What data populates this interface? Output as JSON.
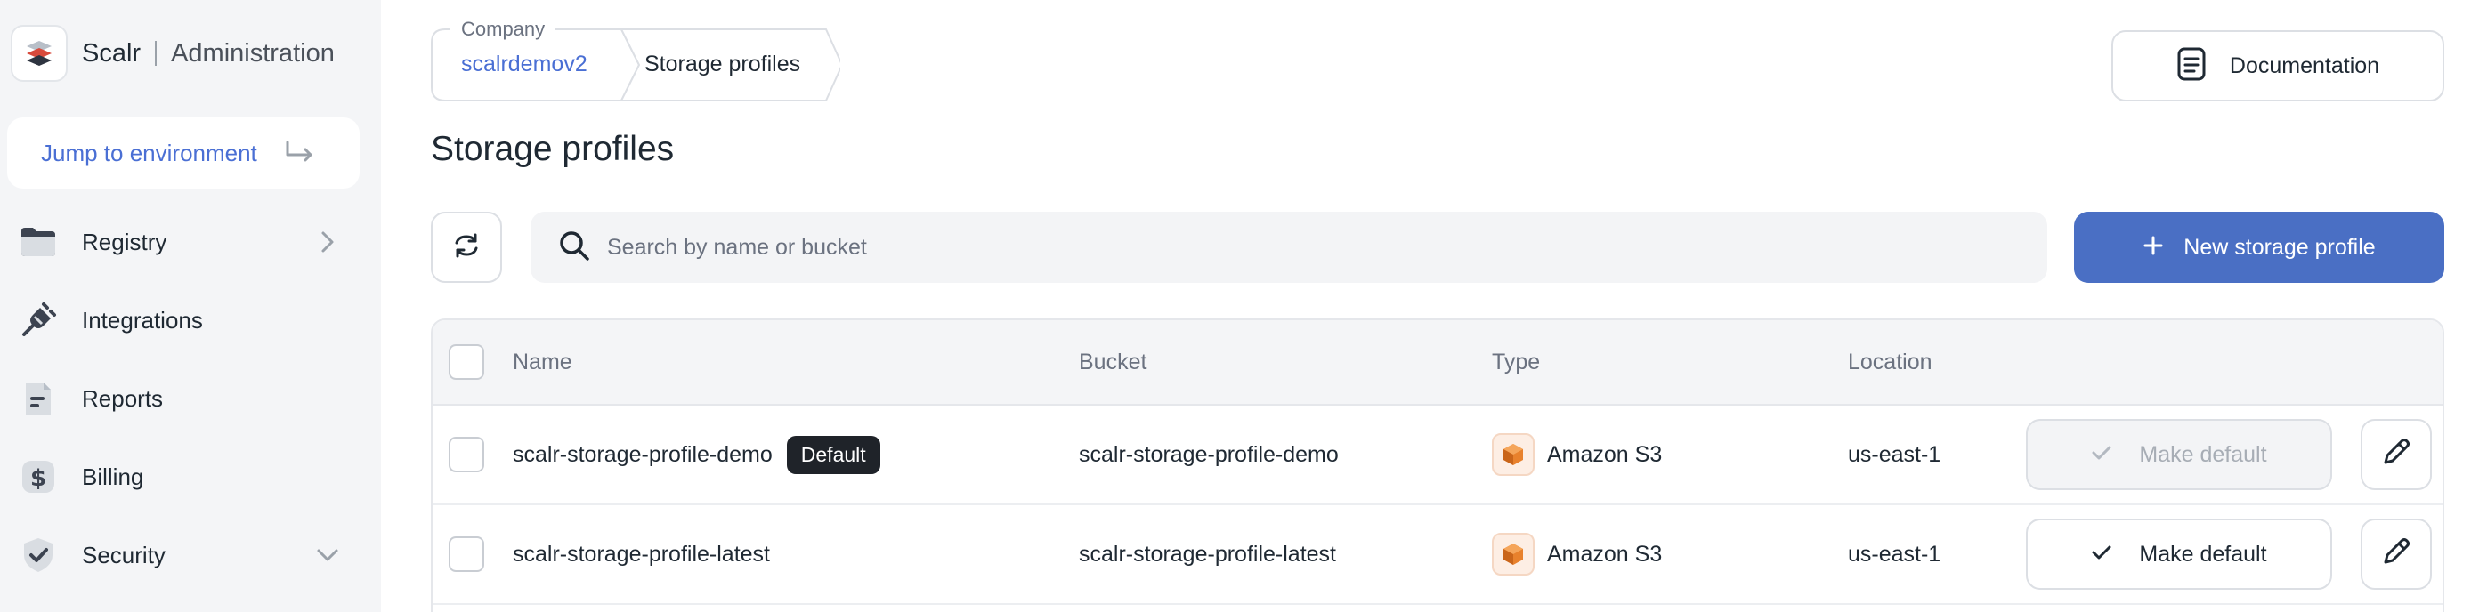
{
  "sidebar": {
    "brand_name": "Scalr",
    "area": "Administration",
    "jump_label": "Jump to environment",
    "items": [
      {
        "label": "Registry",
        "icon": "folder-icon",
        "chevron": "right"
      },
      {
        "label": "Integrations",
        "icon": "plug-icon",
        "chevron": null
      },
      {
        "label": "Reports",
        "icon": "report-icon",
        "chevron": null
      },
      {
        "label": "Billing",
        "icon": "dollar-icon",
        "chevron": null
      },
      {
        "label": "Security",
        "icon": "shield-icon",
        "chevron": "down"
      }
    ]
  },
  "breadcrumb": {
    "company_label": "Company",
    "company": "scalrdemov2",
    "current": "Storage profiles"
  },
  "header": {
    "documentation_label": "Documentation"
  },
  "page": {
    "title": "Storage profiles"
  },
  "toolbar": {
    "search_placeholder": "Search by name or bucket",
    "new_label": "New storage profile"
  },
  "table": {
    "columns": {
      "name": "Name",
      "bucket": "Bucket",
      "type": "Type",
      "location": "Location"
    },
    "rows": [
      {
        "name": "scalr-storage-profile-demo",
        "badge": "Default",
        "bucket": "scalr-storage-profile-demo",
        "type": "Amazon S3",
        "location": "us-east-1",
        "action": "Make default",
        "action_disabled": true
      },
      {
        "name": "scalr-storage-profile-latest",
        "badge": null,
        "bucket": "scalr-storage-profile-latest",
        "type": "Amazon S3",
        "location": "us-east-1",
        "action": "Make default",
        "action_disabled": false
      }
    ]
  },
  "colors": {
    "accent": "#4a6fc4",
    "link": "#4a6fd4",
    "sidebar_bg": "#f4f5f7",
    "badge_bg": "#1f2329",
    "aws_orange": "#e8812c"
  }
}
